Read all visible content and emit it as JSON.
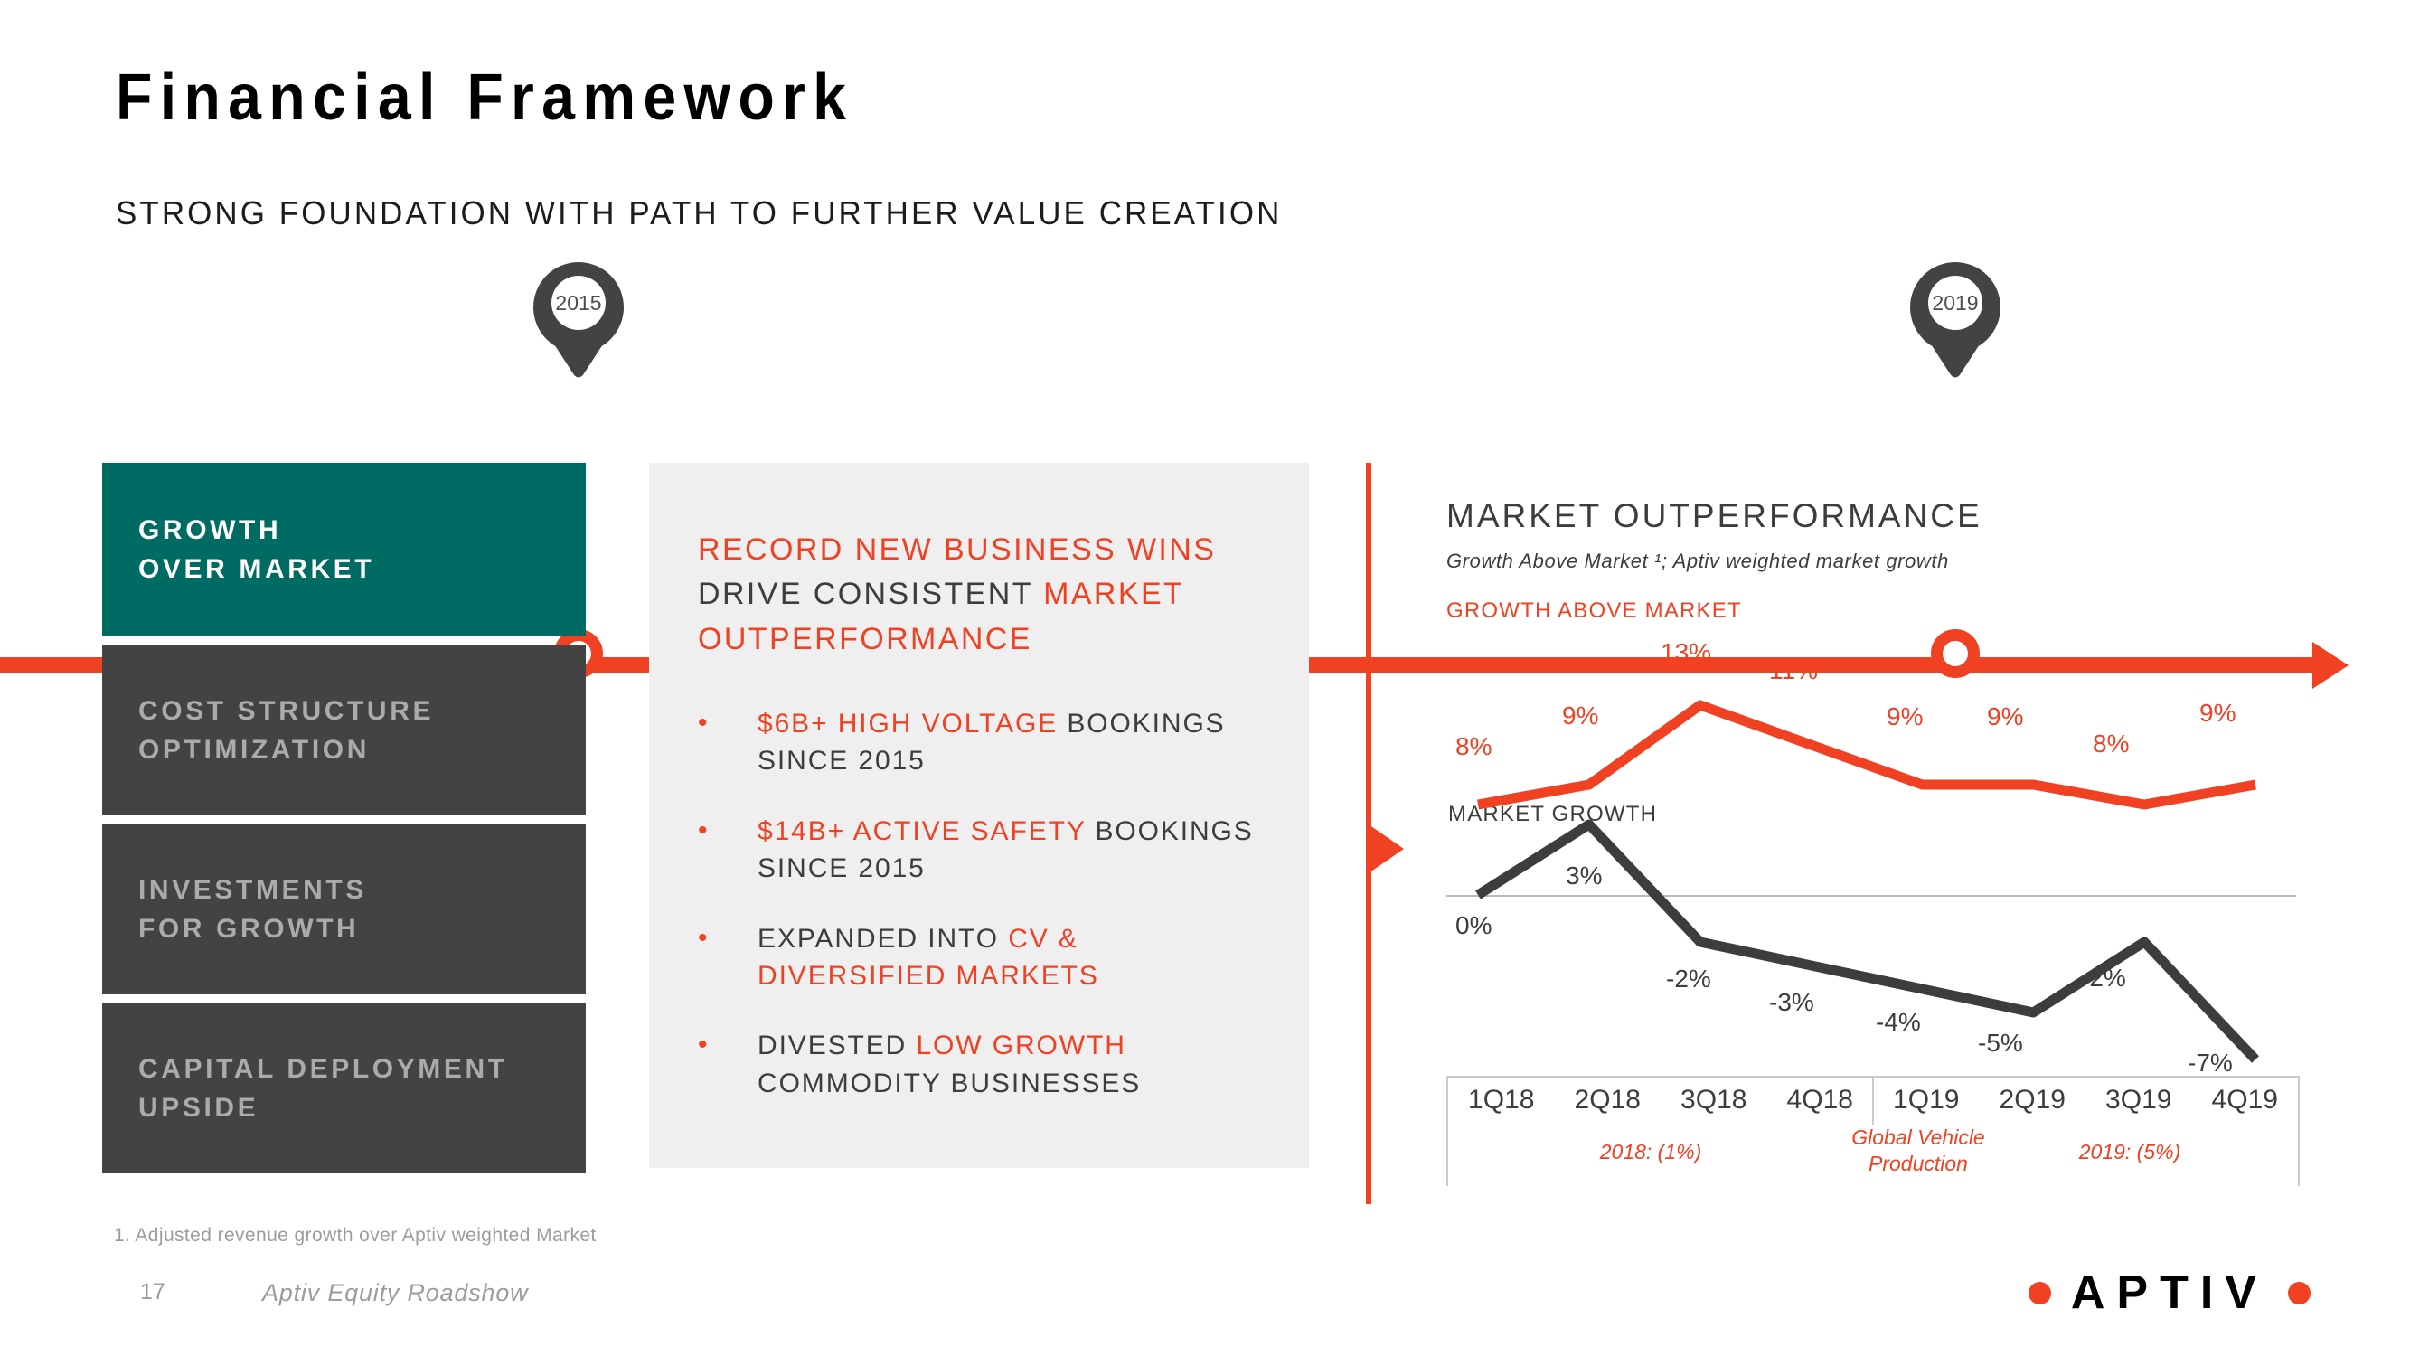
{
  "header": {
    "title": "Financial Framework",
    "subtitle": "STRONG FOUNDATION WITH PATH TO FURTHER VALUE CREATION"
  },
  "timeline": {
    "start_label": "2015",
    "end_label": "2019",
    "color": "#F04123"
  },
  "pillars": [
    {
      "line1": "GROWTH",
      "line2": "OVER MARKET",
      "state": "active"
    },
    {
      "line1": "COST STRUCTURE",
      "line2": "OPTIMIZATION",
      "state": "dim"
    },
    {
      "line1": "INVESTMENTS",
      "line2": "FOR GROWTH",
      "state": "dim"
    },
    {
      "line1": "CAPITAL DEPLOYMENT",
      "line2": "UPSIDE",
      "state": "dim"
    }
  ],
  "center": {
    "heading": {
      "part1": "RECORD NEW BUSINESS WINS",
      "part2": "DRIVE CONSISTENT ",
      "part3": "MARKET OUTPERFORMANCE"
    },
    "bullet_marker": "•",
    "bullets": [
      {
        "highlight": "$6B+ HIGH VOLTAGE",
        "rest": " BOOKINGS SINCE 2015"
      },
      {
        "highlight": "$14B+ ACTIVE SAFETY",
        "rest": " BOOKINGS SINCE 2015"
      },
      {
        "lead": "EXPANDED INTO ",
        "highlight2": "CV & DIVERSIFIED MARKETS"
      },
      {
        "lead": "DIVESTED ",
        "highlight2": "LOW GROWTH",
        "tail": " COMMODITY BUSINESSES"
      }
    ]
  },
  "chart_data": {
    "type": "line",
    "title": "MARKET OUTPERFORMANCE",
    "subtitle": "Growth Above Market ¹; Aptiv weighted market growth",
    "categories": [
      "1Q18",
      "2Q18",
      "3Q18",
      "4Q18",
      "1Q19",
      "2Q19",
      "3Q19",
      "4Q19"
    ],
    "xlabel": "",
    "ylabel": "",
    "ylim": [
      -8,
      14
    ],
    "grid": false,
    "legend": "inline-series-labels",
    "series": [
      {
        "name": "GROWTH ABOVE MARKET",
        "color": "#F04123",
        "values": [
          8,
          9,
          13,
          11,
          9,
          9,
          8,
          9
        ],
        "labels": [
          "8%",
          "9%",
          "13%",
          "11%",
          "9%",
          "9%",
          "8%",
          "9%"
        ]
      },
      {
        "name": "MARKET GROWTH",
        "color": "#3b3d3f",
        "values": [
          0,
          3,
          -2,
          -3,
          -4,
          -5,
          -2,
          -7
        ],
        "labels": [
          "0%",
          "3%",
          "-2%",
          "-3%",
          "-4%",
          "-5%",
          "-2%",
          "-7%"
        ]
      }
    ],
    "annotations": [
      {
        "text": "2018: (1%)",
        "color": "#F04123"
      },
      {
        "text": "Global Vehicle Production",
        "color": "#F04123"
      },
      {
        "text": "2019: (5%)",
        "color": "#F04123"
      }
    ]
  },
  "footer": {
    "footnote": "1. Adjusted revenue growth over Aptiv weighted Market",
    "page_number": "17",
    "deck_name": "Aptiv Equity Roadshow",
    "logo_text": "APTIV"
  }
}
